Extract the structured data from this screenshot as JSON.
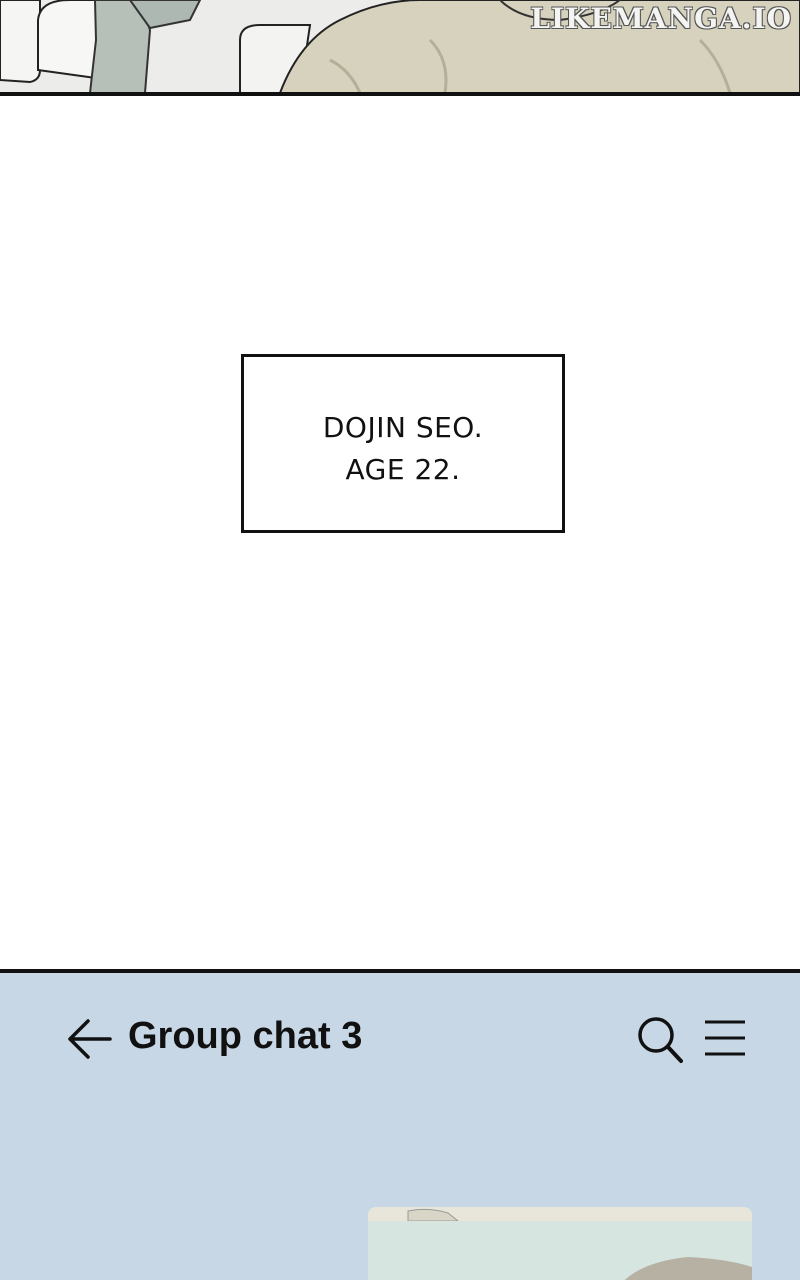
{
  "top_panel": {
    "watermark": "LIKEMANGA.IO"
  },
  "caption": {
    "line1": "DOJIN SEO.",
    "line2": "AGE 22."
  },
  "chat": {
    "title": "Group chat 3",
    "back_icon": "arrow-left-icon",
    "search_icon": "search-icon",
    "menu_icon": "hamburger-menu-icon",
    "background_color": "#c8d7e6"
  }
}
